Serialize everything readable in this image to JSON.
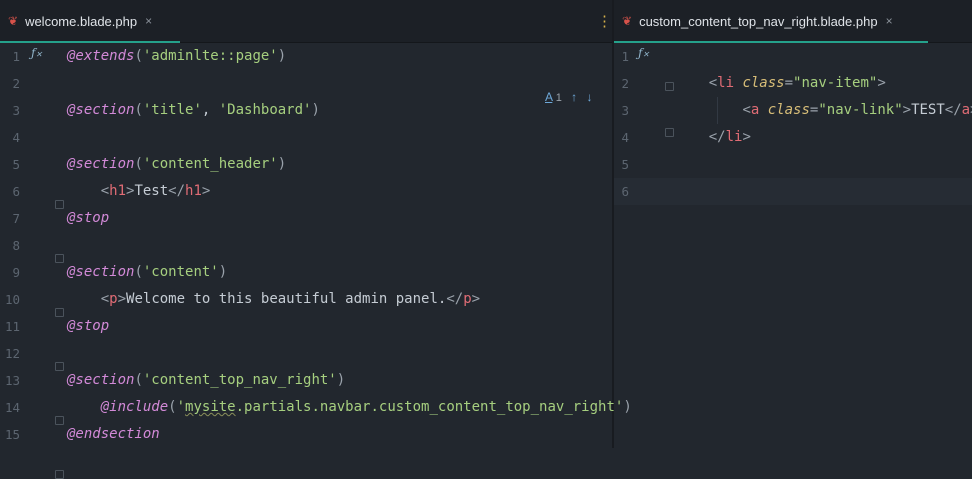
{
  "tabs": [
    {
      "label": "welcome.blade.php",
      "active": true
    },
    {
      "label": "custom_content_top_nav_right.blade.php",
      "active": true
    }
  ],
  "more_menu_glyph": "⋮",
  "close_glyph": "×",
  "tab_icon_glyph": "❦",
  "function_icon_glyph": "ƒ",
  "inspection": {
    "count": "1",
    "arrow_up": "↑",
    "arrow_down": "↓",
    "spell_glyph": "A"
  },
  "left_lines": [
    {
      "n": "1",
      "segs": [
        [
          "dir",
          "@extends"
        ],
        [
          "brk",
          "("
        ],
        [
          "str",
          "'adminlte::page'"
        ],
        [
          "brk",
          ")"
        ]
      ]
    },
    {
      "n": "2",
      "segs": []
    },
    {
      "n": "3",
      "segs": [
        [
          "dir",
          "@section"
        ],
        [
          "brk",
          "("
        ],
        [
          "str",
          "'title'"
        ],
        [
          "",
          ","
        ],
        [
          "str",
          " 'Dashboard'"
        ],
        [
          "brk",
          ")"
        ]
      ]
    },
    {
      "n": "4",
      "segs": []
    },
    {
      "n": "5",
      "segs": [
        [
          "dir",
          "@section"
        ],
        [
          "brk",
          "("
        ],
        [
          "str",
          "'content_header'"
        ],
        [
          "brk",
          ")"
        ]
      ]
    },
    {
      "n": "6",
      "segs": [
        [
          "",
          "    "
        ],
        [
          "brk",
          "<"
        ],
        [
          "tag",
          "h1"
        ],
        [
          "brk",
          ">"
        ],
        [
          "",
          "Test"
        ],
        [
          "brk",
          "</"
        ],
        [
          "tag",
          "h1"
        ],
        [
          "brk",
          ">"
        ]
      ]
    },
    {
      "n": "7",
      "segs": [
        [
          "dir",
          "@stop"
        ]
      ]
    },
    {
      "n": "8",
      "segs": []
    },
    {
      "n": "9",
      "segs": [
        [
          "dir",
          "@section"
        ],
        [
          "brk",
          "("
        ],
        [
          "str",
          "'content'"
        ],
        [
          "brk",
          ")"
        ]
      ]
    },
    {
      "n": "10",
      "segs": [
        [
          "",
          "    "
        ],
        [
          "brk",
          "<"
        ],
        [
          "tag",
          "p"
        ],
        [
          "brk",
          ">"
        ],
        [
          "",
          "Welcome to this beautiful admin panel."
        ],
        [
          "brk",
          "</"
        ],
        [
          "tag",
          "p"
        ],
        [
          "brk",
          ">"
        ]
      ]
    },
    {
      "n": "11",
      "segs": [
        [
          "dir",
          "@stop"
        ]
      ]
    },
    {
      "n": "12",
      "segs": []
    },
    {
      "n": "13",
      "segs": [
        [
          "dir",
          "@section"
        ],
        [
          "brk",
          "("
        ],
        [
          "str",
          "'content_top_nav_right'"
        ],
        [
          "brk",
          ")"
        ]
      ]
    },
    {
      "n": "14",
      "segs": [
        [
          "",
          "    "
        ],
        [
          "dir",
          "@include"
        ],
        [
          "brk",
          "("
        ],
        [
          "str",
          "'"
        ],
        [
          "str squig",
          "mysite"
        ],
        [
          "str",
          ".partials.navbar.custom_content_top_nav_right'"
        ],
        [
          "brk",
          ")"
        ]
      ]
    },
    {
      "n": "15",
      "segs": [
        [
          "dir",
          "@endsection"
        ]
      ]
    }
  ],
  "right_lines": [
    {
      "n": "1",
      "segs": []
    },
    {
      "n": "2",
      "segs": [
        [
          "",
          "    "
        ],
        [
          "brk",
          "<"
        ],
        [
          "tag",
          "li"
        ],
        [
          "",
          " "
        ],
        [
          "attr",
          "class"
        ],
        [
          "brk",
          "="
        ],
        [
          "str",
          "\"nav-item\""
        ],
        [
          "brk",
          ">"
        ]
      ]
    },
    {
      "n": "3",
      "segs": [
        [
          "",
          "        "
        ],
        [
          "brk",
          "<"
        ],
        [
          "tag",
          "a"
        ],
        [
          "",
          " "
        ],
        [
          "attr",
          "class"
        ],
        [
          "brk",
          "="
        ],
        [
          "str",
          "\"nav-link\""
        ],
        [
          "brk",
          ">"
        ],
        [
          "",
          "TEST"
        ],
        [
          "brk",
          "</"
        ],
        [
          "tag",
          "a"
        ],
        [
          "brk",
          ">"
        ]
      ]
    },
    {
      "n": "4",
      "segs": [
        [
          "",
          "    "
        ],
        [
          "brk",
          "</"
        ],
        [
          "tag",
          "li"
        ],
        [
          "brk",
          ">"
        ]
      ]
    },
    {
      "n": "5",
      "segs": []
    },
    {
      "n": "6",
      "segs": []
    }
  ],
  "colors": {
    "background": "#22272e",
    "tab_accent": "#25a18b",
    "string": "#a6cf7f",
    "directive": "#d38ad8",
    "tag": "#e06c75"
  }
}
